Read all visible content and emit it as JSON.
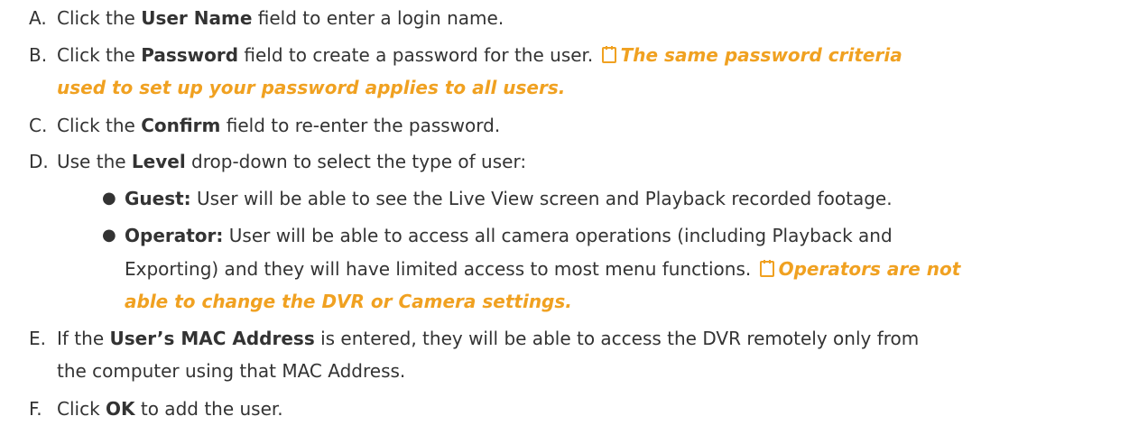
{
  "accent_color": "#f0a121",
  "icons": {
    "note": "notepad-icon"
  },
  "steps": {
    "a": {
      "letter": "A.",
      "pre": "Click the ",
      "bold": "User Name",
      "post": " field to enter a login name."
    },
    "b": {
      "letter": "B.",
      "pre": "Click the ",
      "bold": "Password",
      "post": " field to create a password for the user. ",
      "note_line1": "The same password criteria",
      "note_line2": "used to set up your password applies to all users."
    },
    "c": {
      "letter": "C.",
      "pre": "Click the ",
      "bold": "Confirm",
      "post": " field to re-enter the password."
    },
    "d": {
      "letter": "D.",
      "pre": "Use the ",
      "bold": "Level",
      "post": " drop-down to select the type of user:",
      "bullets": [
        {
          "bold": "Guest:",
          "text": " User will be able to see the Live View screen and Playback recorded footage."
        },
        {
          "bold": "Operator:",
          "text_line1": " User will be able to access all camera operations (including Playback and",
          "text_line2": "Exporting) and they will have limited access to most menu functions. ",
          "note_line1": "Operators are not",
          "note_line2": "able to change the DVR or Camera settings."
        }
      ]
    },
    "e": {
      "letter": "E.",
      "pre": "If the ",
      "bold": "User’s MAC Address",
      "post_line1": " is entered, they will be able to access the DVR remotely only from",
      "post_line2": "the computer using that MAC Address."
    },
    "f": {
      "letter": "F.",
      "pre": "Click ",
      "bold": "OK",
      "post": " to add the user."
    }
  }
}
